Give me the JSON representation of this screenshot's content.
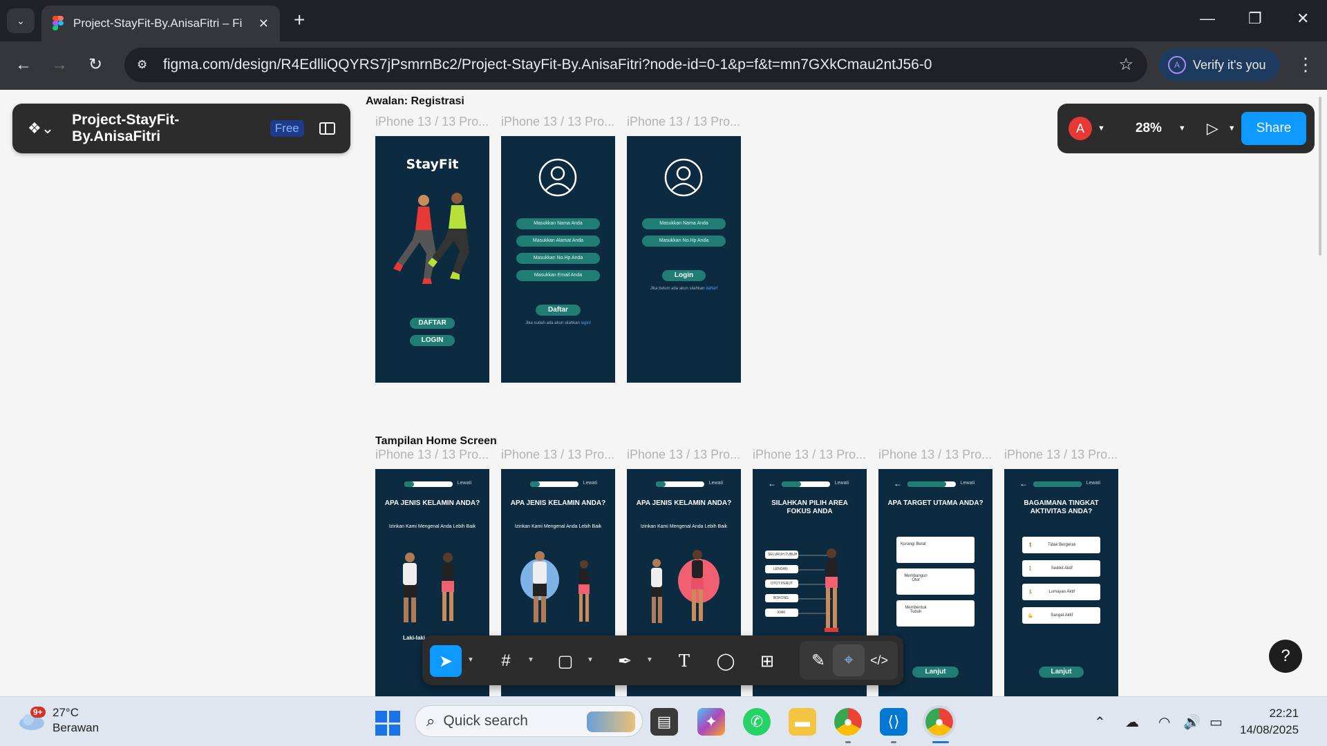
{
  "browser": {
    "tab_title": "Project-StayFit-By.AnisaFitri – Fi",
    "url": "figma.com/design/R4EdlliQQYRS7jPsmrnBc2/Project-StayFit-By.AnisaFitri?node-id=0-1&p=f&t=mn7GXkCmau2ntJ56-0",
    "verify_label": "Verify it's you",
    "profile_initial": "A"
  },
  "figma": {
    "file_name": "Project-StayFit-By.AnisaFitri",
    "plan_badge": "Free",
    "user_initial": "A",
    "zoom": "28%",
    "share_label": "Share",
    "help_label": "?"
  },
  "sections": {
    "registration": "Awalan: Registrasi",
    "home": "Tampilan Home Screen"
  },
  "frame_label": "iPhone 13 / 13 Pro...",
  "screens": {
    "splash": {
      "brand": "StayFit",
      "daftar": "DAFTAR",
      "login": "LOGIN"
    },
    "register": {
      "fields": [
        "Masukkan Nama Anda",
        "Masukkan Alamat Anda",
        "Masukkan No.Hp Anda",
        "Masukkan Email Anda"
      ],
      "button": "Daftar",
      "footer": "Jika sudah ada akun silahkan",
      "footer_link": "login"
    },
    "login": {
      "fields": [
        "Masukkan Nama Anda",
        "Masukkan No.Hp Anda"
      ],
      "button": "Login",
      "footer": "Jika belum ada akun silahkan",
      "footer_link": "daftar"
    },
    "skip": "Lewati",
    "gender": {
      "title": "APA JENIS KELAMIN ANDA?",
      "subtitle": "Izinkan Kami Mengenal Anda Lebih Baik",
      "male_label": "Laki-laki"
    },
    "focus": {
      "title": "SILAHKAN PILIH AREA FOKUS ANDA",
      "areas": [
        "SELURUH TUBUH",
        "LENGAN",
        "OTOT PERUT",
        "BOKONG",
        "KAKI"
      ]
    },
    "target": {
      "title": "APA TARGET UTAMA ANDA?",
      "options": [
        "Kurangi Berat",
        "Membangun Otot",
        "Membentuk Tubuh"
      ],
      "button": "Lanjut"
    },
    "activity": {
      "title": "BAGAIMANA TINGKAT AKTIVITAS ANDA?",
      "options": [
        "Tidak Bergerak",
        "Sedikit Aktif",
        "Lumayan Aktif",
        "Sangat Aktif"
      ],
      "button": "Lanjut"
    }
  },
  "taskbar": {
    "weather_temp": "27°C",
    "weather_desc": "Berawan",
    "notif_badge": "9+",
    "search_placeholder": "Quick search",
    "time": "22:21",
    "date": "14/08/2025"
  }
}
